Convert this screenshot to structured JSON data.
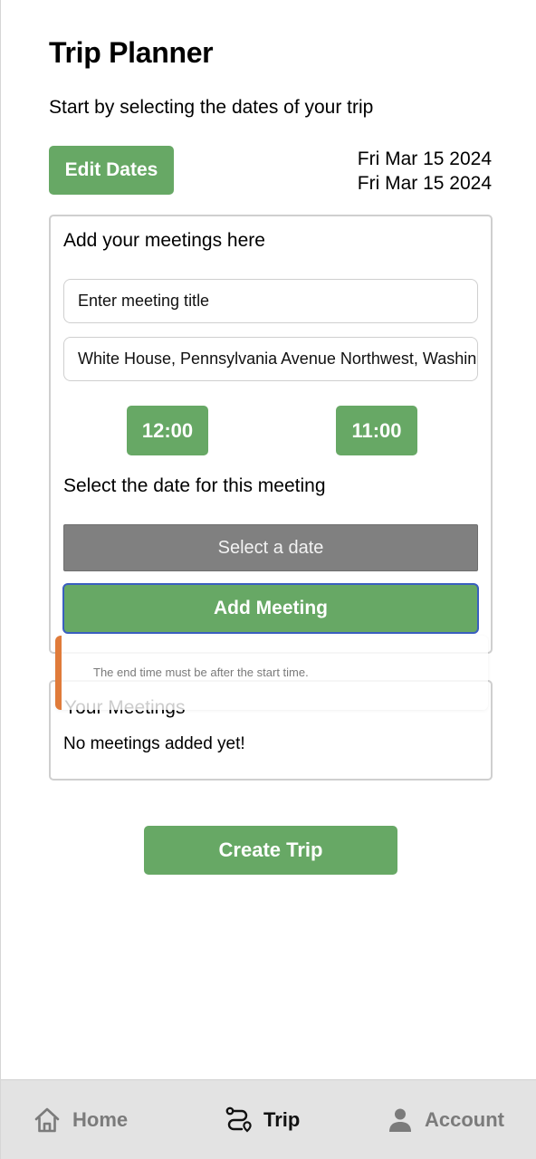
{
  "header": {
    "title": "Trip Planner",
    "subtitle": "Start by selecting the dates of your trip"
  },
  "trip_dates": {
    "edit_label": "Edit Dates",
    "start_date": "Fri Mar 15 2024",
    "end_date": "Fri Mar 15 2024"
  },
  "meeting_form": {
    "heading": "Add your meetings here",
    "title_placeholder": "Enter meeting title",
    "location_value": "White House, Pennsylvania Avenue Northwest, Washington, DC, USA",
    "start_time": "12:00",
    "end_time": "11:00",
    "date_label": "Select the date for this meeting",
    "select_date_label": "Select a date",
    "add_button": "Add Meeting"
  },
  "toast": {
    "message": "The end time must be after the start time.",
    "accent_color": "#e07b3a"
  },
  "meetings": {
    "title": "Your Meetings",
    "empty_text": "No meetings added yet!"
  },
  "actions": {
    "create_trip": "Create Trip"
  },
  "tabbar": {
    "items": [
      {
        "label": "Home",
        "icon": "home-icon",
        "active": false
      },
      {
        "label": "Trip",
        "icon": "route-icon",
        "active": true
      },
      {
        "label": "Account",
        "icon": "person-icon",
        "active": false
      }
    ]
  },
  "colors": {
    "primary_green": "#67a865",
    "select_gray": "#808080",
    "focus_blue": "#3a5fbf",
    "tabbar_bg": "#e3e3e3"
  }
}
